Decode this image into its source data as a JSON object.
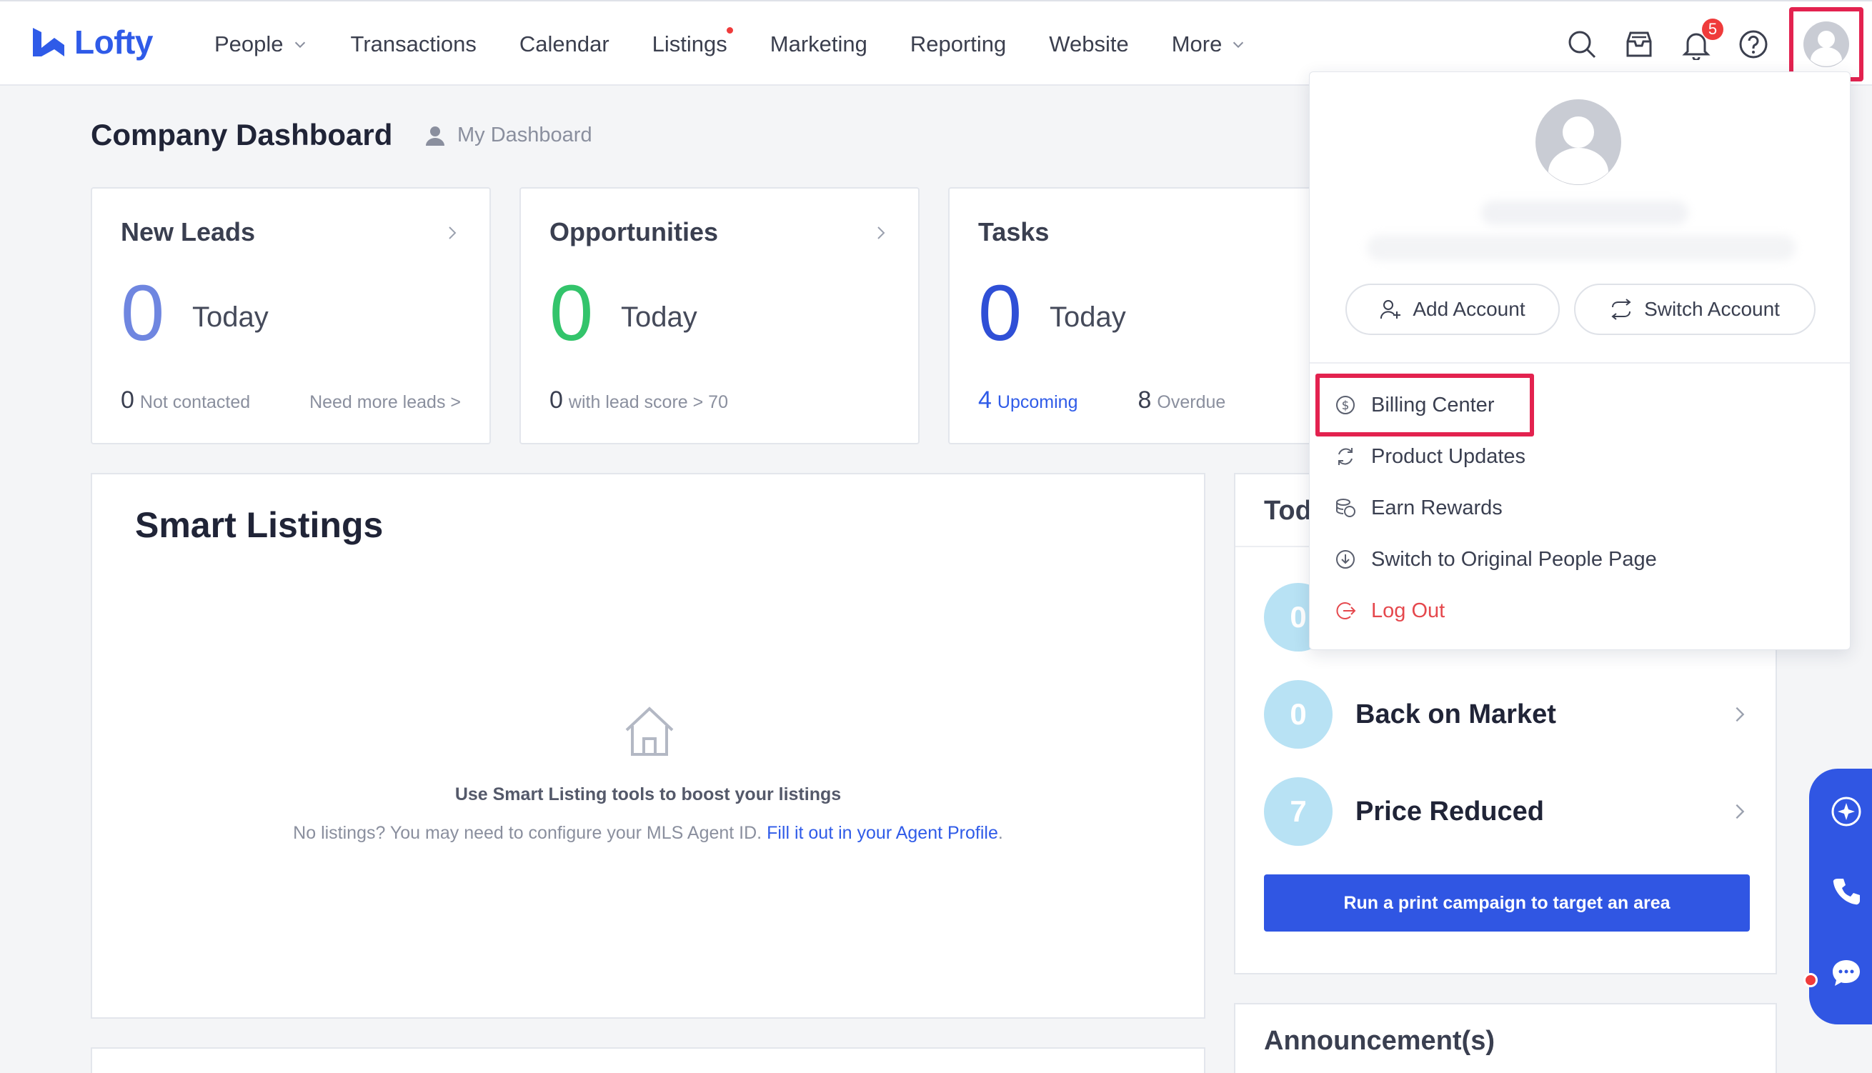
{
  "nav": {
    "logo_text": "Lofty",
    "items": [
      {
        "label": "People",
        "has_dropdown": true
      },
      {
        "label": "Transactions"
      },
      {
        "label": "Calendar"
      },
      {
        "label": "Listings",
        "has_dot": true
      },
      {
        "label": "Marketing"
      },
      {
        "label": "Reporting"
      },
      {
        "label": "Website"
      },
      {
        "label": "More",
        "has_dropdown": true
      }
    ],
    "notification_count": "5",
    "icons": [
      "search-icon",
      "inbox-icon",
      "bell-icon",
      "help-icon",
      "avatar-icon"
    ]
  },
  "page": {
    "title": "Company Dashboard",
    "my_dashboard": "My Dashboard"
  },
  "cards": {
    "new_leads": {
      "title": "New Leads",
      "count": "0",
      "period": "Today",
      "footer_num": "0",
      "footer_text": "Not contacted",
      "link": "Need more leads >"
    },
    "opportunities": {
      "title": "Opportunities",
      "count": "0",
      "period": "Today",
      "footer_num": "0",
      "footer_text": "with lead score > 70"
    },
    "tasks": {
      "title": "Tasks",
      "count": "0",
      "period": "Today",
      "upcoming_num": "4",
      "upcoming_text": "Upcoming",
      "overdue_num": "8",
      "overdue_text": "Overdue"
    }
  },
  "smart_listings": {
    "title": "Smart Listings",
    "heading": "Use Smart Listing tools to boost your listings",
    "sub_text": "No listings? You may need to configure your MLS Agent ID.",
    "link_text": "Fill it out in your Agent Profile",
    "link_suffix": "."
  },
  "right_panel": {
    "title": "Tod",
    "rows": [
      {
        "count": "0",
        "label": ""
      },
      {
        "count": "0",
        "label": "Back on Market"
      },
      {
        "count": "7",
        "label": "Price Reduced"
      }
    ],
    "cta": "Run a print campaign to target an area"
  },
  "announcements": {
    "title": "Announcement(s)"
  },
  "account_menu": {
    "add_account": "Add Account",
    "switch_account": "Switch Account",
    "items": [
      {
        "label": "Billing Center",
        "icon": "dollar-circle-icon"
      },
      {
        "label": "Product Updates",
        "icon": "refresh-icon"
      },
      {
        "label": "Earn Rewards",
        "icon": "coins-icon"
      },
      {
        "label": "Switch to Original People Page",
        "icon": "download-circle-icon"
      },
      {
        "label": "Log Out",
        "icon": "logout-icon"
      }
    ]
  },
  "colors": {
    "brand": "#2f5be8",
    "leads_number": "#6f86e0",
    "opportunities_number": "#33c46b",
    "tasks_number": "#2f4fd6",
    "highlight": "#e3224f",
    "logout": "#e5484d",
    "circle": "#b8e2f4"
  }
}
